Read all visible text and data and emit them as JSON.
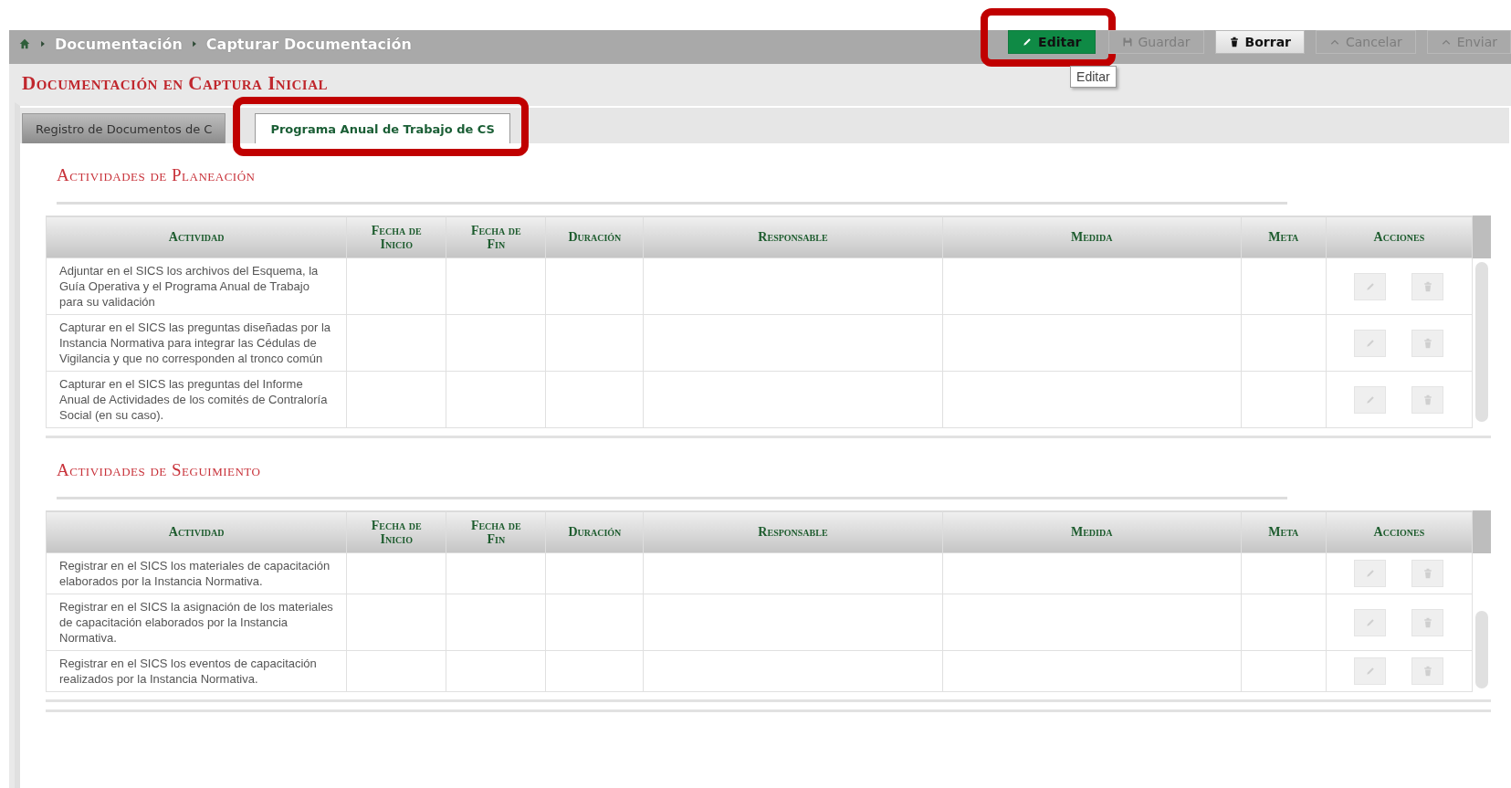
{
  "breadcrumb": [
    "Documentación",
    "Capturar Documentación"
  ],
  "toolbar": [
    {
      "label": "Editar",
      "kind": "edit",
      "disabled": false,
      "highlighted": true,
      "tooltip": "Editar"
    },
    {
      "label": "Guardar",
      "kind": "save",
      "disabled": true,
      "highlighted": false
    },
    {
      "label": "Borrar",
      "kind": "delete",
      "disabled": false,
      "highlighted": false
    },
    {
      "label": "Cancelar",
      "kind": "cancel",
      "disabled": true,
      "highlighted": false
    },
    {
      "label": "Enviar",
      "kind": "send",
      "disabled": true,
      "highlighted": false
    }
  ],
  "page_title": "Documentación en Captura Inicial",
  "tabs": [
    {
      "label": "Registro de Documentos de C",
      "selected": false,
      "highlighted": false
    },
    {
      "label": "Programa Anual de Trabajo de CS",
      "selected": true,
      "highlighted": true
    }
  ],
  "sections": [
    {
      "title": "Actividades de Planeación",
      "columns": [
        "Actividad",
        "Fecha de Inicio",
        "Fecha de Fin",
        "Duración",
        "Responsable",
        "Medida",
        "Meta",
        "Acciones"
      ],
      "rows": [
        {
          "actividad": "Adjuntar en el SICS los archivos del Esquema, la Guía Operativa y el Programa Anual de Trabajo para su validación",
          "actions_disabled": true
        },
        {
          "actividad": "Capturar en el SICS las preguntas diseñadas por la Instancia Normativa para integrar las Cédulas de Vigilancia y que no corresponden al tronco común",
          "actions_disabled": true
        },
        {
          "actividad": "Capturar en el SICS las preguntas del Informe Anual de Actividades de los comités de Contraloría Social (en su caso).",
          "actions_disabled": true
        }
      ]
    },
    {
      "title": "Actividades de Seguimiento",
      "columns": [
        "Actividad",
        "Fecha de Inicio",
        "Fecha de Fin",
        "Duración",
        "Responsable",
        "Medida",
        "Meta",
        "Acciones"
      ],
      "rows": [
        {
          "actividad": "Registrar en el SICS los materiales de capacitación elaborados por la Instancia Normativa.",
          "actions_disabled": true
        },
        {
          "actividad": "Registrar en el SICS la asignación de los materiales de capacitación elaborados por la Instancia Normativa.",
          "actions_disabled": true
        },
        {
          "actividad": "Registrar en el SICS los eventos de capacitación realizados por la Instancia Normativa.",
          "actions_disabled": true
        }
      ]
    }
  ]
}
